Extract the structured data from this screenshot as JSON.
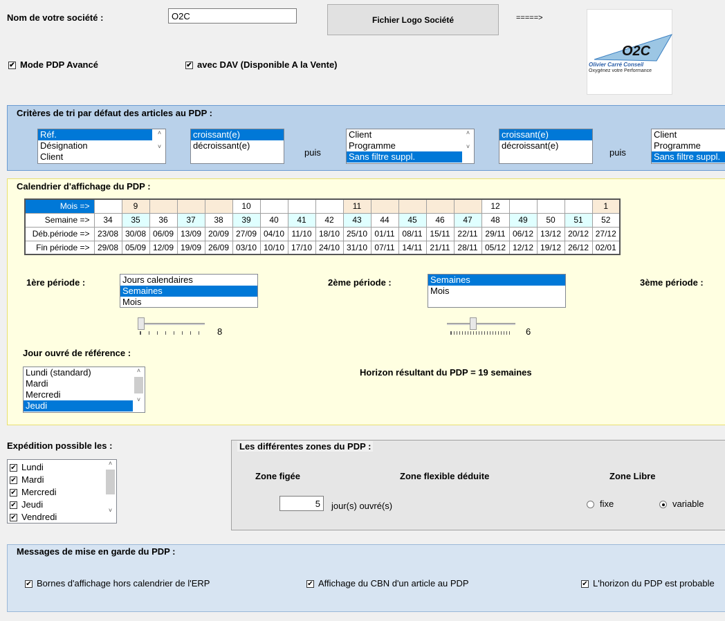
{
  "company": {
    "label": "Nom de votre société :",
    "value": "O2C",
    "logo_button": "Fichier Logo Société",
    "arrow": "=====>",
    "logo": {
      "letters": "O2C",
      "name": "Olivier Carré Conseil",
      "tagline": "Oxygénez votre Performance"
    }
  },
  "options": {
    "advanced_mode": {
      "label": "Mode PDP Avancé",
      "checked": true
    },
    "dav": {
      "label": "avec DAV (Disponible A la Vente)",
      "checked": true
    }
  },
  "sort": {
    "title": "Critères de tri par défaut des articles au PDP :",
    "then": "puis",
    "list1": {
      "items": [
        "Réf.",
        "Désignation",
        "Client"
      ],
      "selected": 0
    },
    "order1": {
      "items": [
        "croissant(e)",
        "décroissant(e)"
      ],
      "selected": 0
    },
    "list2": {
      "items": [
        "Client",
        "Programme",
        "Sans filtre suppl."
      ],
      "selected": 2
    },
    "order2": {
      "items": [
        "croissant(e)",
        "décroissant(e)"
      ],
      "selected": 0
    },
    "list3": {
      "items": [
        "Client",
        "Programme",
        "Sans filtre suppl."
      ],
      "selected": 2
    }
  },
  "calendar": {
    "title": "Calendrier d'affichage du PDP :",
    "row_labels": [
      "Mois =>",
      "Semaine =>",
      "Déb.période =>",
      "Fin période =>"
    ],
    "months": [
      "",
      "9",
      "",
      "",
      "",
      "10",
      "",
      "",
      "",
      "11",
      "",
      "",
      "",
      "",
      "12",
      "",
      "",
      "",
      "1"
    ],
    "month_shaded": [
      false,
      true,
      true,
      true,
      true,
      false,
      false,
      false,
      false,
      true,
      true,
      true,
      true,
      true,
      false,
      false,
      false,
      false,
      true
    ],
    "weeks": [
      "34",
      "35",
      "36",
      "37",
      "38",
      "39",
      "40",
      "41",
      "42",
      "43",
      "44",
      "45",
      "46",
      "47",
      "48",
      "49",
      "50",
      "51",
      "52"
    ],
    "start": [
      "23/08",
      "30/08",
      "06/09",
      "13/09",
      "20/09",
      "27/09",
      "04/10",
      "11/10",
      "18/10",
      "25/10",
      "01/11",
      "08/11",
      "15/11",
      "22/11",
      "29/11",
      "06/12",
      "13/12",
      "20/12",
      "27/12"
    ],
    "end": [
      "29/08",
      "05/09",
      "12/09",
      "19/09",
      "26/09",
      "03/10",
      "10/10",
      "17/10",
      "24/10",
      "31/10",
      "07/11",
      "14/11",
      "21/11",
      "28/11",
      "05/12",
      "12/12",
      "19/12",
      "26/12",
      "02/01"
    ],
    "period1": {
      "label": "1ère période :",
      "items": [
        "Jours calendaires",
        "Semaines",
        "Mois"
      ],
      "selected": 1,
      "value": "8"
    },
    "period2": {
      "label": "2ème période :",
      "items": [
        "Semaines",
        "Mois"
      ],
      "selected": 0,
      "value": "6"
    },
    "period3": {
      "label": "3ème période :"
    },
    "ref_day": {
      "label": "Jour ouvré de référence :",
      "items": [
        "Lundi (standard)",
        "Mardi",
        "Mercredi",
        "Jeudi"
      ],
      "selected": 3
    },
    "horizon": "Horizon résultant du PDP = 19 semaines"
  },
  "shipping": {
    "label": "Expédition possible les :",
    "items": [
      "Lundi",
      "Mardi",
      "Mercredi",
      "Jeudi",
      "Vendredi"
    ]
  },
  "zones": {
    "title": "Les différentes zones du PDP :",
    "frozen": "Zone figée",
    "flexible": "Zone flexible déduite",
    "free": "Zone Libre",
    "frozen_value": "5",
    "frozen_unit": "jour(s) ouvré(s)",
    "fixed": "fixe",
    "variable": "variable",
    "selected": "variable"
  },
  "warnings": {
    "title": "Messages de mise en garde du PDP :",
    "items": [
      "Bornes d'affichage hors calendrier de l'ERP",
      "Affichage du CBN d'un article au PDP",
      "L'horizon du PDP est probable"
    ]
  }
}
